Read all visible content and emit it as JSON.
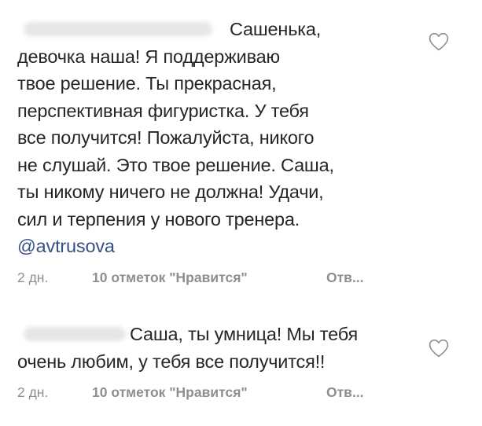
{
  "comments": [
    {
      "first_line": "Сашенька,",
      "lines": [
        "девочка наша! Я поддерживаю",
        "твое решение. Ты прекрасная,",
        "перспективная фигуристка. У тебя",
        "все получится! Пожалуйста, никого",
        "не слушай. Это твое решение. Саша,",
        "ты никому ничего не должна! Удачи,",
        "сил и терпения у нового тренера."
      ],
      "mention": "@avtrusova",
      "age": "2 дн.",
      "likes": "10 отметок \"Нравится\"",
      "reply": "Отв...",
      "heart_icon": "heart-outline-icon"
    },
    {
      "first_line": "Саша, ты умница! Мы тебя",
      "lines": [
        "очень любим, у тебя все получится!!"
      ],
      "age": "2 дн.",
      "likes": "10 отметок \"Нравится\"",
      "reply": "Отв...",
      "heart_icon": "heart-outline-icon"
    }
  ],
  "colors": {
    "text": "#262626",
    "muted": "#8e8e8e",
    "mention": "#385185",
    "background": "#ffffff"
  }
}
